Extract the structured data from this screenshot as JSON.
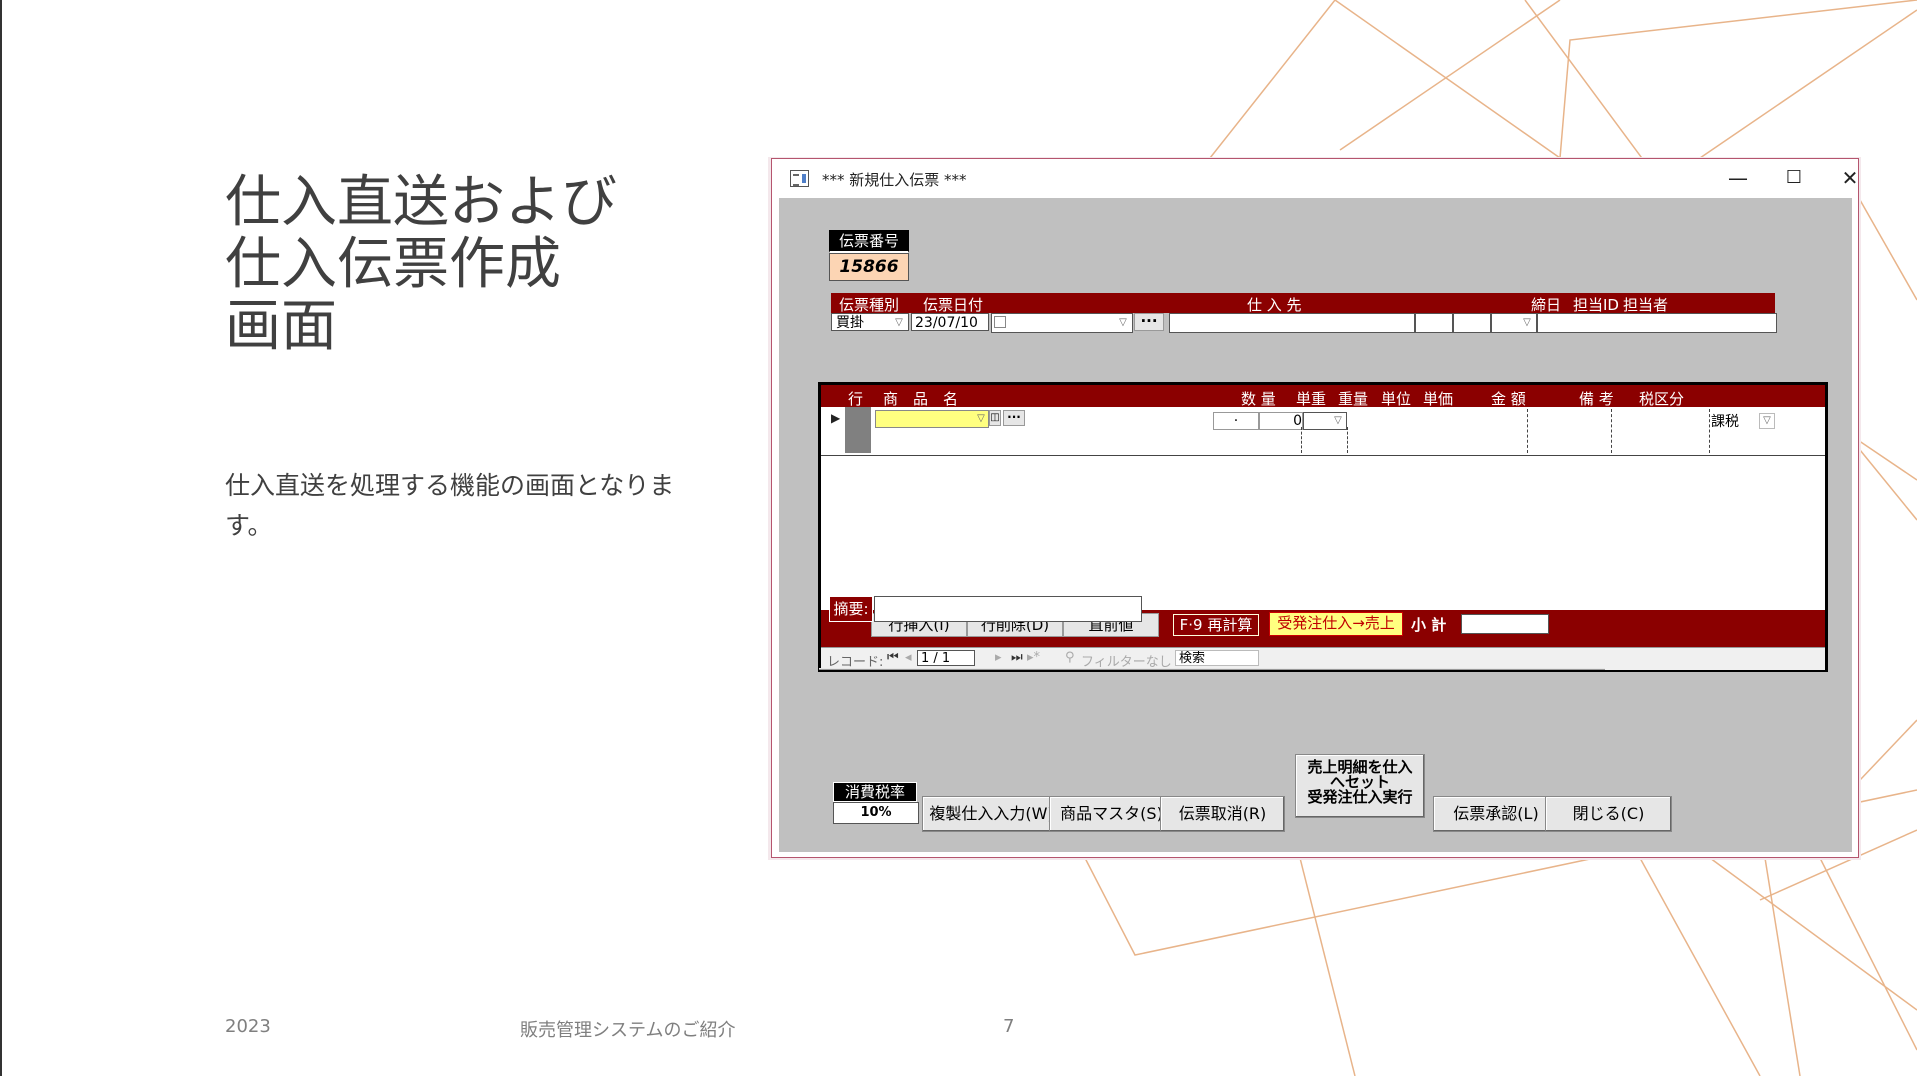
{
  "slide": {
    "title_lines": [
      "仕入直送および",
      "仕入伝票作成",
      "画面"
    ],
    "body": "仕入直送を処理する機能の画面となります。",
    "footer": {
      "year": "2023",
      "center": "販売管理システムのご紹介",
      "page": "7"
    }
  },
  "window": {
    "title": "*** 新規仕入伝票 ***",
    "controls": {
      "minimize": "—",
      "maximize": "☐",
      "close": "✕"
    }
  },
  "form": {
    "slip_no_label": "伝票番号",
    "slip_no_value": "15866",
    "header_labels": {
      "slip_type": "伝票種別",
      "slip_date": "伝票日付",
      "supplier": "仕 入 先",
      "closing_day": "締日",
      "staff_id": "担当ID",
      "staff_name": "担当者"
    },
    "slip_type_value": "買掛",
    "slip_date_value": "23/07/10",
    "lookup_button": "···"
  },
  "detail": {
    "columns": {
      "line": "行",
      "product_name": "商　品　名",
      "quantity": "数 量",
      "unit_weight": "単重",
      "weight": "重量",
      "unit": "単位",
      "unit_price": "単価",
      "amount": "金 額",
      "remarks": "備 考",
      "tax_type": "税区分"
    },
    "row": {
      "unit_weight": "·",
      "weight": "0",
      "tax_type": "課税",
      "lookup": "···"
    },
    "footer_buttons": {
      "insert": "行挿入(I)",
      "delete": "行削除(D)",
      "prev_value": "直前値",
      "recalc": "F·9 再計算",
      "order_flow": "受発注仕入→売上"
    },
    "subtotal_label": "小 計",
    "nav": {
      "record_label": "レコード:",
      "position": "1 / 1",
      "filter": "フィルターなし",
      "search": "検索"
    }
  },
  "summary_label": "摘要:",
  "tax": {
    "label": "消費税率",
    "value": "10%"
  },
  "buttons": {
    "copy_input": "複製仕入入力(W)",
    "product_master": "商品マスタ(S)",
    "cancel_slip": "伝票取消(R)",
    "set_sales_lines": [
      "売上明細を仕入",
      "へセット",
      "受発注仕入実行"
    ],
    "approve": "伝票承認(L)",
    "close": "閉じる(C)"
  },
  "colors": {
    "header_red": "#8b0000",
    "form_gray": "#c0c0c0",
    "slip_no_bg": "#fcd5b4",
    "highlight_yellow": "#ffff80",
    "deco_lines": "#e8b48a"
  }
}
